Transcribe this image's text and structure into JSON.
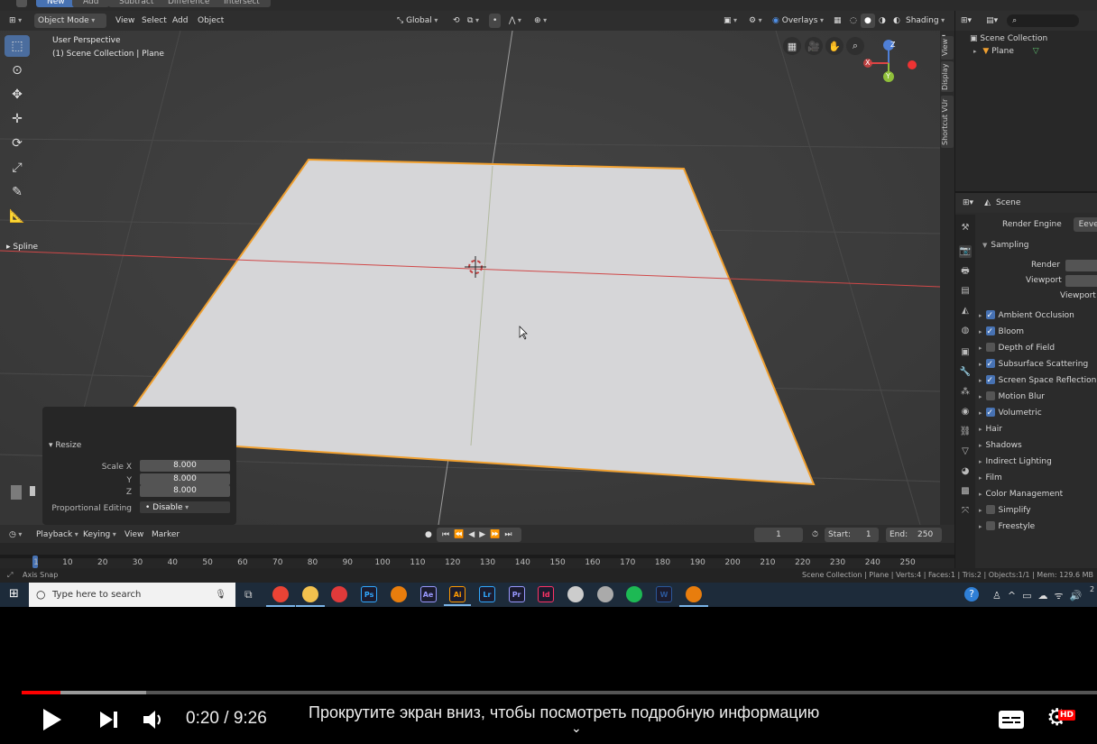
{
  "blender": {
    "top_tabs": [
      "New",
      "Add",
      "Subtract",
      "Difference",
      "Intersect"
    ],
    "header": {
      "mode": "Object Mode",
      "menus": [
        "View",
        "Select",
        "Add",
        "Object"
      ],
      "transform_orientation": "Global",
      "overlays": "Overlays",
      "shading": "Shading"
    },
    "viewport": {
      "perspective": "User Perspective",
      "collection_info": "(1) Scene Collection | Plane",
      "spline_label": "Spline",
      "gizmo_axes": {
        "x": "X",
        "y": "Y",
        "z": "Z"
      }
    },
    "side_tabs": [
      "View",
      "Display",
      "Shortcut VUr"
    ],
    "redo_panel": {
      "title": "Resize",
      "scale_x_label": "Scale X",
      "y_label": "Y",
      "z_label": "Z",
      "scale_x": "8.000",
      "scale_y": "8.000",
      "scale_z": "8.000",
      "proportional_label": "Proportional Editing",
      "proportional_value": "Disable"
    },
    "outliner": {
      "root": "Scene Collection",
      "items": [
        "Plane"
      ]
    },
    "properties": {
      "context": "Scene",
      "render_engine_label": "Render Engine",
      "render_engine": "Eevee",
      "sampling": "Sampling",
      "render_label": "Render",
      "viewport_label": "Viewport",
      "viewport_denoise": "Viewport D",
      "panels": [
        {
          "label": "Ambient Occlusion",
          "checked": true
        },
        {
          "label": "Bloom",
          "checked": true
        },
        {
          "label": "Depth of Field",
          "checked": false
        },
        {
          "label": "Subsurface Scattering",
          "checked": true
        },
        {
          "label": "Screen Space Reflection",
          "checked": true
        },
        {
          "label": "Motion Blur",
          "checked": false
        },
        {
          "label": "Volumetric",
          "checked": true
        },
        {
          "label": "Hair",
          "checked": null
        },
        {
          "label": "Shadows",
          "checked": null
        },
        {
          "label": "Indirect Lighting",
          "checked": null
        },
        {
          "label": "Film",
          "checked": null
        },
        {
          "label": "Color Management",
          "checked": null
        },
        {
          "label": "Simplify",
          "checked": false
        },
        {
          "label": "Freestyle",
          "checked": false
        }
      ]
    },
    "timeline": {
      "menus": [
        "Playback",
        "Keying",
        "View",
        "Marker"
      ],
      "current_frame": "1",
      "start_label": "Start:",
      "start": "1",
      "end_label": "End:",
      "end": "250",
      "ticks": [
        "1",
        "10",
        "20",
        "30",
        "40",
        "50",
        "60",
        "70",
        "80",
        "90",
        "100",
        "110",
        "120",
        "130",
        "140",
        "150",
        "160",
        "170",
        "180",
        "190",
        "200",
        "210",
        "220",
        "230",
        "240",
        "250"
      ]
    },
    "status": {
      "left": "Axis Snap",
      "right": "Scene Collection | Plane | Verts:4 | Faces:1 | Tris:2 | Objects:1/1 | Mem: 129.6 MB"
    }
  },
  "taskbar": {
    "search_placeholder": "Type here to search",
    "apps": [
      {
        "name": "Chrome",
        "glyph": "",
        "color": "#ea4335"
      },
      {
        "name": "File Explorer",
        "glyph": "",
        "color": "#f2c14e"
      },
      {
        "name": "App",
        "glyph": "",
        "color": "#e03a3a"
      },
      {
        "name": "Photoshop",
        "glyph": "Ps",
        "color": "#31a8ff"
      },
      {
        "name": "Blender",
        "glyph": "",
        "color": "#e87d0d"
      },
      {
        "name": "After Effects",
        "glyph": "Ae",
        "color": "#9999ff"
      },
      {
        "name": "Illustrator",
        "glyph": "Ai",
        "color": "#ff9a00"
      },
      {
        "name": "Lightroom",
        "glyph": "Lr",
        "color": "#31a8ff"
      },
      {
        "name": "Premiere",
        "glyph": "Pr",
        "color": "#9999ff"
      },
      {
        "name": "InDesign",
        "glyph": "Id",
        "color": "#ff3366"
      },
      {
        "name": "OBS",
        "glyph": "",
        "color": "#cccccc"
      },
      {
        "name": "App",
        "glyph": "",
        "color": "#aaaaaa"
      },
      {
        "name": "Spotify",
        "glyph": "",
        "color": "#1db954"
      },
      {
        "name": "Word",
        "glyph": "W",
        "color": "#2b579a"
      },
      {
        "name": "Blender",
        "glyph": "",
        "color": "#e87d0d"
      }
    ]
  },
  "player": {
    "progress": 0.036,
    "buffered": 0.116,
    "time_current": "0:20",
    "time_total": "9:26",
    "hint": "Прокрутите экран вниз, чтобы посмотреть подробную информацию",
    "hd_badge": "HD"
  }
}
